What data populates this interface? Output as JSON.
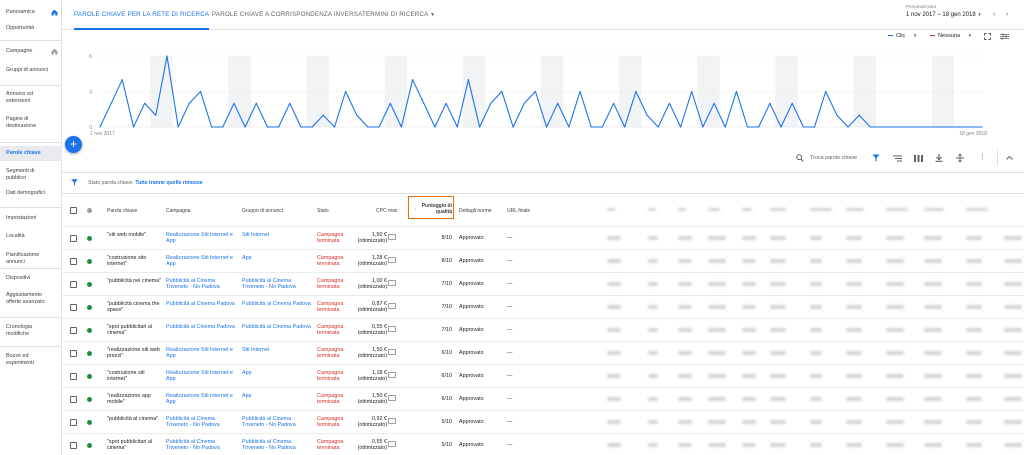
{
  "sidebar": {
    "items": [
      {
        "label": "Panoramica",
        "home": true
      },
      {
        "label": "Opportunità"
      },
      {
        "label": "Campagne",
        "home": true
      },
      {
        "label": "Gruppi di annunci"
      },
      {
        "label": "Annunci ed estensioni"
      },
      {
        "label": "Pagine di destinazione"
      },
      {
        "label": "Parole chiave",
        "active": true
      },
      {
        "label": "Segmenti di pubblico"
      },
      {
        "label": "Dati demografici"
      },
      {
        "label": "Impostazioni"
      },
      {
        "label": "Località"
      },
      {
        "label": "Pianificazione annunci"
      },
      {
        "label": "Dispositivi"
      },
      {
        "label": "Aggiustamento offerte avanzato"
      },
      {
        "label": "Cronologia modifiche"
      },
      {
        "label": "Bozze ed esperimenti"
      }
    ]
  },
  "tabs": [
    {
      "label": "Parole chiave per la rete di ricerca",
      "active": true
    },
    {
      "label": "Parole chiave a corrispondenza inversa"
    },
    {
      "label": "Termini di ricerca"
    }
  ],
  "date_range": {
    "label": "Personalizzato",
    "value": "1 nov 2017 – 18 gen 2018"
  },
  "chart_legend": {
    "metric1": "Clic",
    "metric1_color": "#1a73e8",
    "metric2": "Nessuna",
    "metric2_color": "#d93025"
  },
  "chart_data": {
    "type": "line",
    "y_ticks": [
      "6",
      "3",
      "0"
    ],
    "ylim": [
      0,
      6
    ],
    "x_start_label": "1 nov 2017",
    "x_end_label": "18 gen 2018",
    "series": [
      {
        "values": [
          0,
          2,
          4,
          0,
          2,
          1,
          6,
          0,
          2,
          3,
          0,
          0,
          2,
          0,
          2,
          0,
          0,
          2,
          0,
          0,
          1,
          0,
          3,
          1,
          0,
          0,
          2,
          0,
          4,
          2,
          0,
          2,
          0,
          4,
          0,
          2,
          3,
          0,
          2,
          3,
          0,
          2,
          0,
          3,
          0,
          0,
          2,
          0,
          3,
          1,
          0,
          2,
          0,
          3,
          0,
          2,
          0,
          3,
          0,
          0,
          2,
          0,
          2,
          0,
          0,
          3,
          1,
          0,
          1,
          0,
          0,
          0,
          0,
          0,
          0,
          0,
          0,
          0,
          0,
          0
        ]
      }
    ]
  },
  "toolbar": {
    "search_label": "Trova parole chiave"
  },
  "filter": {
    "prefix": "Stato parola chiave:",
    "value": "Tutte tranne quelle rimosse"
  },
  "table": {
    "headers": {
      "keyword": "Parola chiave",
      "campaign": "Campagna",
      "adgroup": "Gruppo di annunci",
      "status": "Stato",
      "cpc": "CPC max",
      "quality": "Punteggio di qualità",
      "policy": "Dettagli norme",
      "url": "URL finale"
    },
    "rows": [
      {
        "keyword": "\"siti web mobile\"",
        "campaign": "Realizzazione Siti Internet e App",
        "adgroup": "Siti Internet",
        "status": "Campagna terminata",
        "cpc": "1,50 € (ottimizzato)",
        "quality": "8/10",
        "policy": "Approvato",
        "url": "—"
      },
      {
        "keyword": "\"costruzione sito internet\"",
        "campaign": "Realizzazione Siti Internet e App",
        "adgroup": "App",
        "status": "Campagna terminata",
        "cpc": "1,28 € (ottimizzato)",
        "quality": "8/10",
        "policy": "Approvato",
        "url": "—"
      },
      {
        "keyword": "\"pubblicità nei cinema\"",
        "campaign": "Pubblicità al Cinema Triveneto - No Padova",
        "adgroup": "Pubblicità al Cinema Triveneto - No Padova",
        "status": "Campagna terminata",
        "cpc": "1,00 € (ottimizzato)",
        "quality": "7/10",
        "policy": "Approvato",
        "url": "—"
      },
      {
        "keyword": "\"pubblicità cinema the space\"",
        "campaign": "Pubblicità al Cinema Padova",
        "adgroup": "Pubblicità al Cinema Padova",
        "status": "Campagna terminata",
        "cpc": "0,87 € (ottimizzato)",
        "quality": "7/10",
        "policy": "Approvato",
        "url": "—"
      },
      {
        "keyword": "\"spot pubblicitari al cinema\"",
        "campaign": "Pubblicità al Cinema Padova",
        "adgroup": "Pubblicità al Cinema Padova",
        "status": "Campagna terminata",
        "cpc": "0,55 € (ottimizzato)",
        "quality": "7/10",
        "policy": "Approvato",
        "url": "—"
      },
      {
        "keyword": "\"realizzazione siti web prezzi\"",
        "campaign": "Realizzazione Siti Internet e App",
        "adgroup": "Siti Internet",
        "status": "Campagna terminata",
        "cpc": "1,50 € (ottimizzato)",
        "quality": "6/10",
        "policy": "Approvato",
        "url": "—"
      },
      {
        "keyword": "\"costruzione siti internet\"",
        "campaign": "Realizzazione Siti Internet e App",
        "adgroup": "App",
        "status": "Campagna terminata",
        "cpc": "1,18 € (ottimizzato)",
        "quality": "6/10",
        "policy": "Approvato",
        "url": "—"
      },
      {
        "keyword": "\"realizzazione app mobile\"",
        "campaign": "Realizzazione Siti Internet e App",
        "adgroup": "App",
        "status": "Campagna terminata",
        "cpc": "1,50 € (ottimizzato)",
        "quality": "6/10",
        "policy": "Approvato",
        "url": "—"
      },
      {
        "keyword": "\"pubblicità al cinema\"",
        "campaign": "Pubblicità al Cinema Triveneto - No Padova",
        "adgroup": "Pubblicità al Cinema Triveneto - No Padova",
        "status": "Campagna terminata",
        "cpc": "0,92 € (ottimizzato)",
        "quality": "5/10",
        "policy": "Approvato",
        "url": "—"
      },
      {
        "keyword": "\"spot pubblicitari al cinema\"",
        "campaign": "Pubblicità al Cinema Triveneto - No Padova",
        "adgroup": "Pubblicità al Cinema Triveneto - No Padova",
        "status": "Campagna terminata",
        "cpc": "0,55 € (ottimizzato)",
        "quality": "5/10",
        "policy": "Approvato",
        "url": "—"
      }
    ]
  },
  "icons": {
    "home": "home-icon",
    "fab": "add-icon",
    "search": "search-icon",
    "filter": "filter-icon",
    "segment": "segment-icon",
    "columns": "columns-icon",
    "download": "download-icon",
    "expand": "expand-icon",
    "more": "more-vert-icon",
    "collapse": "collapse-icon"
  }
}
